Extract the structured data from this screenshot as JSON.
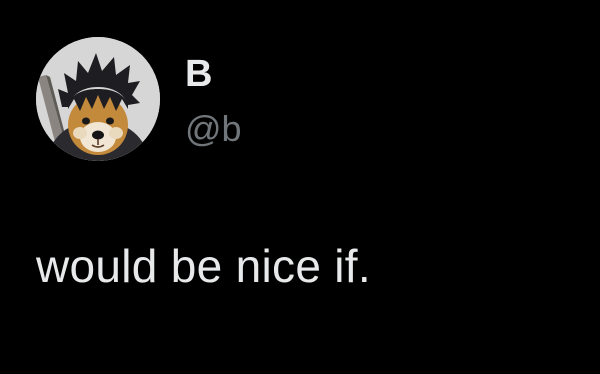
{
  "theme": {
    "background": "#000000",
    "primary_text_color": "#e7e9ea",
    "secondary_text_color": "#71767b"
  },
  "author": {
    "avatar_icon": "dog-with-spiky-hair-avatar",
    "display_name": "B",
    "handle": "@b"
  },
  "tweet": {
    "text": "would be nice if."
  }
}
